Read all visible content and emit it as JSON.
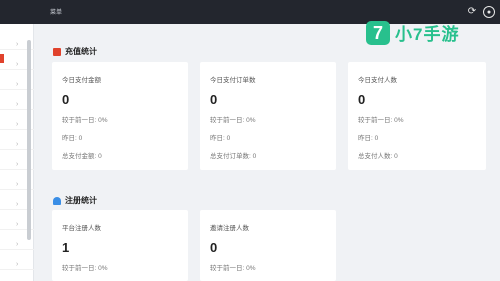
{
  "topbar": {
    "menu_text": "菜单",
    "refresh_icon": "refresh-icon",
    "user_icon": "user-circle-icon"
  },
  "sidebar": {
    "chevron": "›"
  },
  "recharge": {
    "title": "充值统计",
    "icon_color": "#e0422c",
    "cards": [
      {
        "title": "今日支付金额",
        "value": "0",
        "compare": "较于前一日: 0%",
        "yesterday": "昨日: 0",
        "total": "总支付金额: 0"
      },
      {
        "title": "今日支付订单数",
        "value": "0",
        "compare": "较于前一日: 0%",
        "yesterday": "昨日: 0",
        "total": "总支付订单数: 0"
      },
      {
        "title": "今日支付人数",
        "value": "0",
        "compare": "较于前一日: 0%",
        "yesterday": "昨日: 0",
        "total": "总支付人数: 0"
      }
    ]
  },
  "register": {
    "title": "注册统计",
    "icon_color": "#3a8ee6",
    "cards": [
      {
        "title": "平台注册人数",
        "value": "1",
        "compare": "较于前一日: 0%"
      },
      {
        "title": "邀请注册人数",
        "value": "0",
        "compare": "较于前一日: 0%"
      }
    ]
  },
  "watermark": {
    "badge": "7",
    "text": "小7手游",
    "color": "#28c08d"
  }
}
